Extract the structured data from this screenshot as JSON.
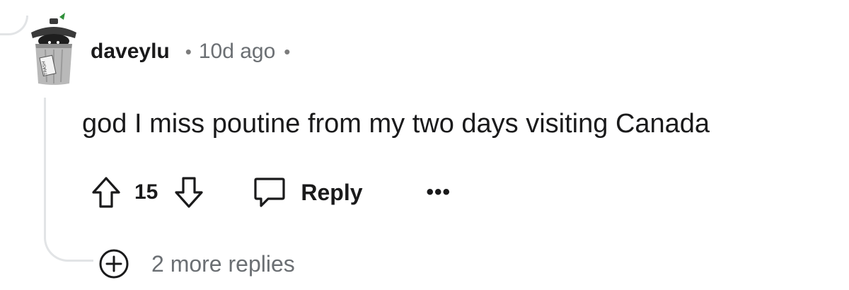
{
  "comment": {
    "author": "daveylu",
    "separator": "•",
    "timestamp": "10d ago",
    "body": "god I miss poutine from my two days visiting Canada",
    "avatar_icon": "trash-can-avatar-icon",
    "avatar_label": "TRASH"
  },
  "actions": {
    "upvote_icon": "arrow-up-icon",
    "score": "15",
    "downvote_icon": "arrow-down-icon",
    "reply_icon": "speech-bubble-icon",
    "reply_label": "Reply",
    "more_label": "•••"
  },
  "more_replies": {
    "icon": "plus-circle-icon",
    "label": "2 more replies"
  },
  "colors": {
    "text": "#1a1a1b",
    "muted": "#6b6f73",
    "thread_line": "#e2e4e6"
  }
}
